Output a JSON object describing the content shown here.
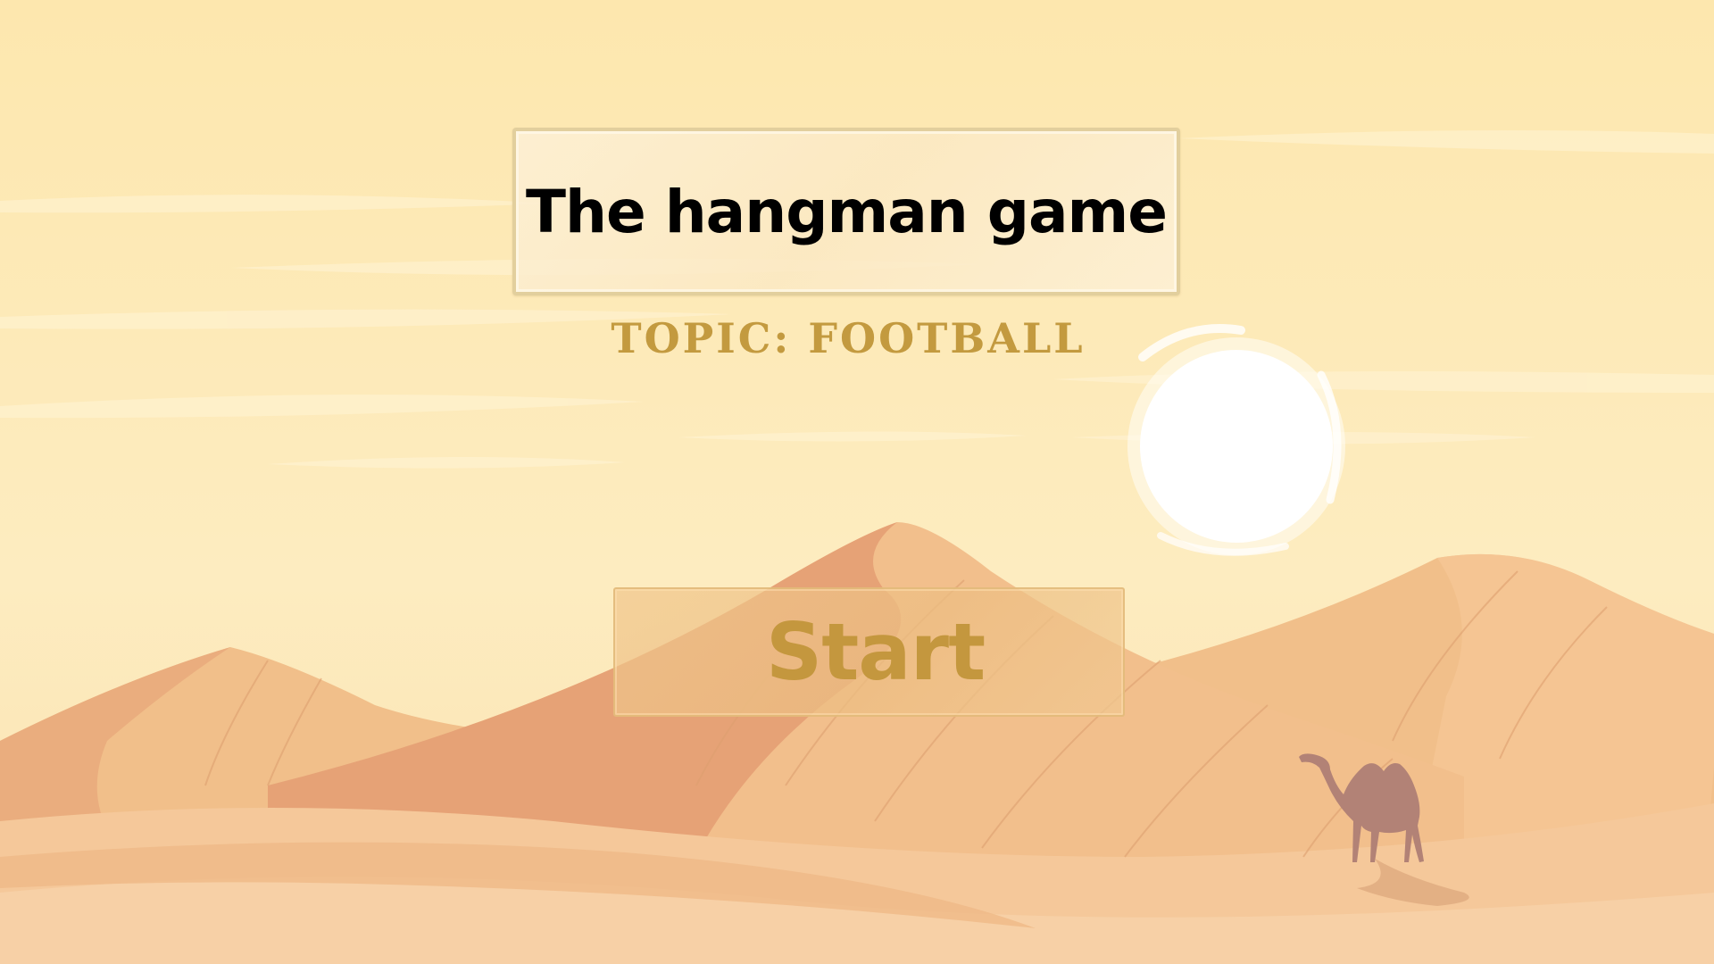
{
  "game": {
    "title": "The hangman game",
    "topic": "TOPIC: FOOTBALL",
    "start_label": "Start"
  },
  "colors": {
    "sky": "#fde9b4",
    "title_text": "#000000",
    "topic_text": "#c39a3f",
    "start_text": "#c4973e",
    "sun": "#ffffff"
  },
  "icons": {
    "sun": "sun-icon",
    "camel": "camel-icon"
  }
}
